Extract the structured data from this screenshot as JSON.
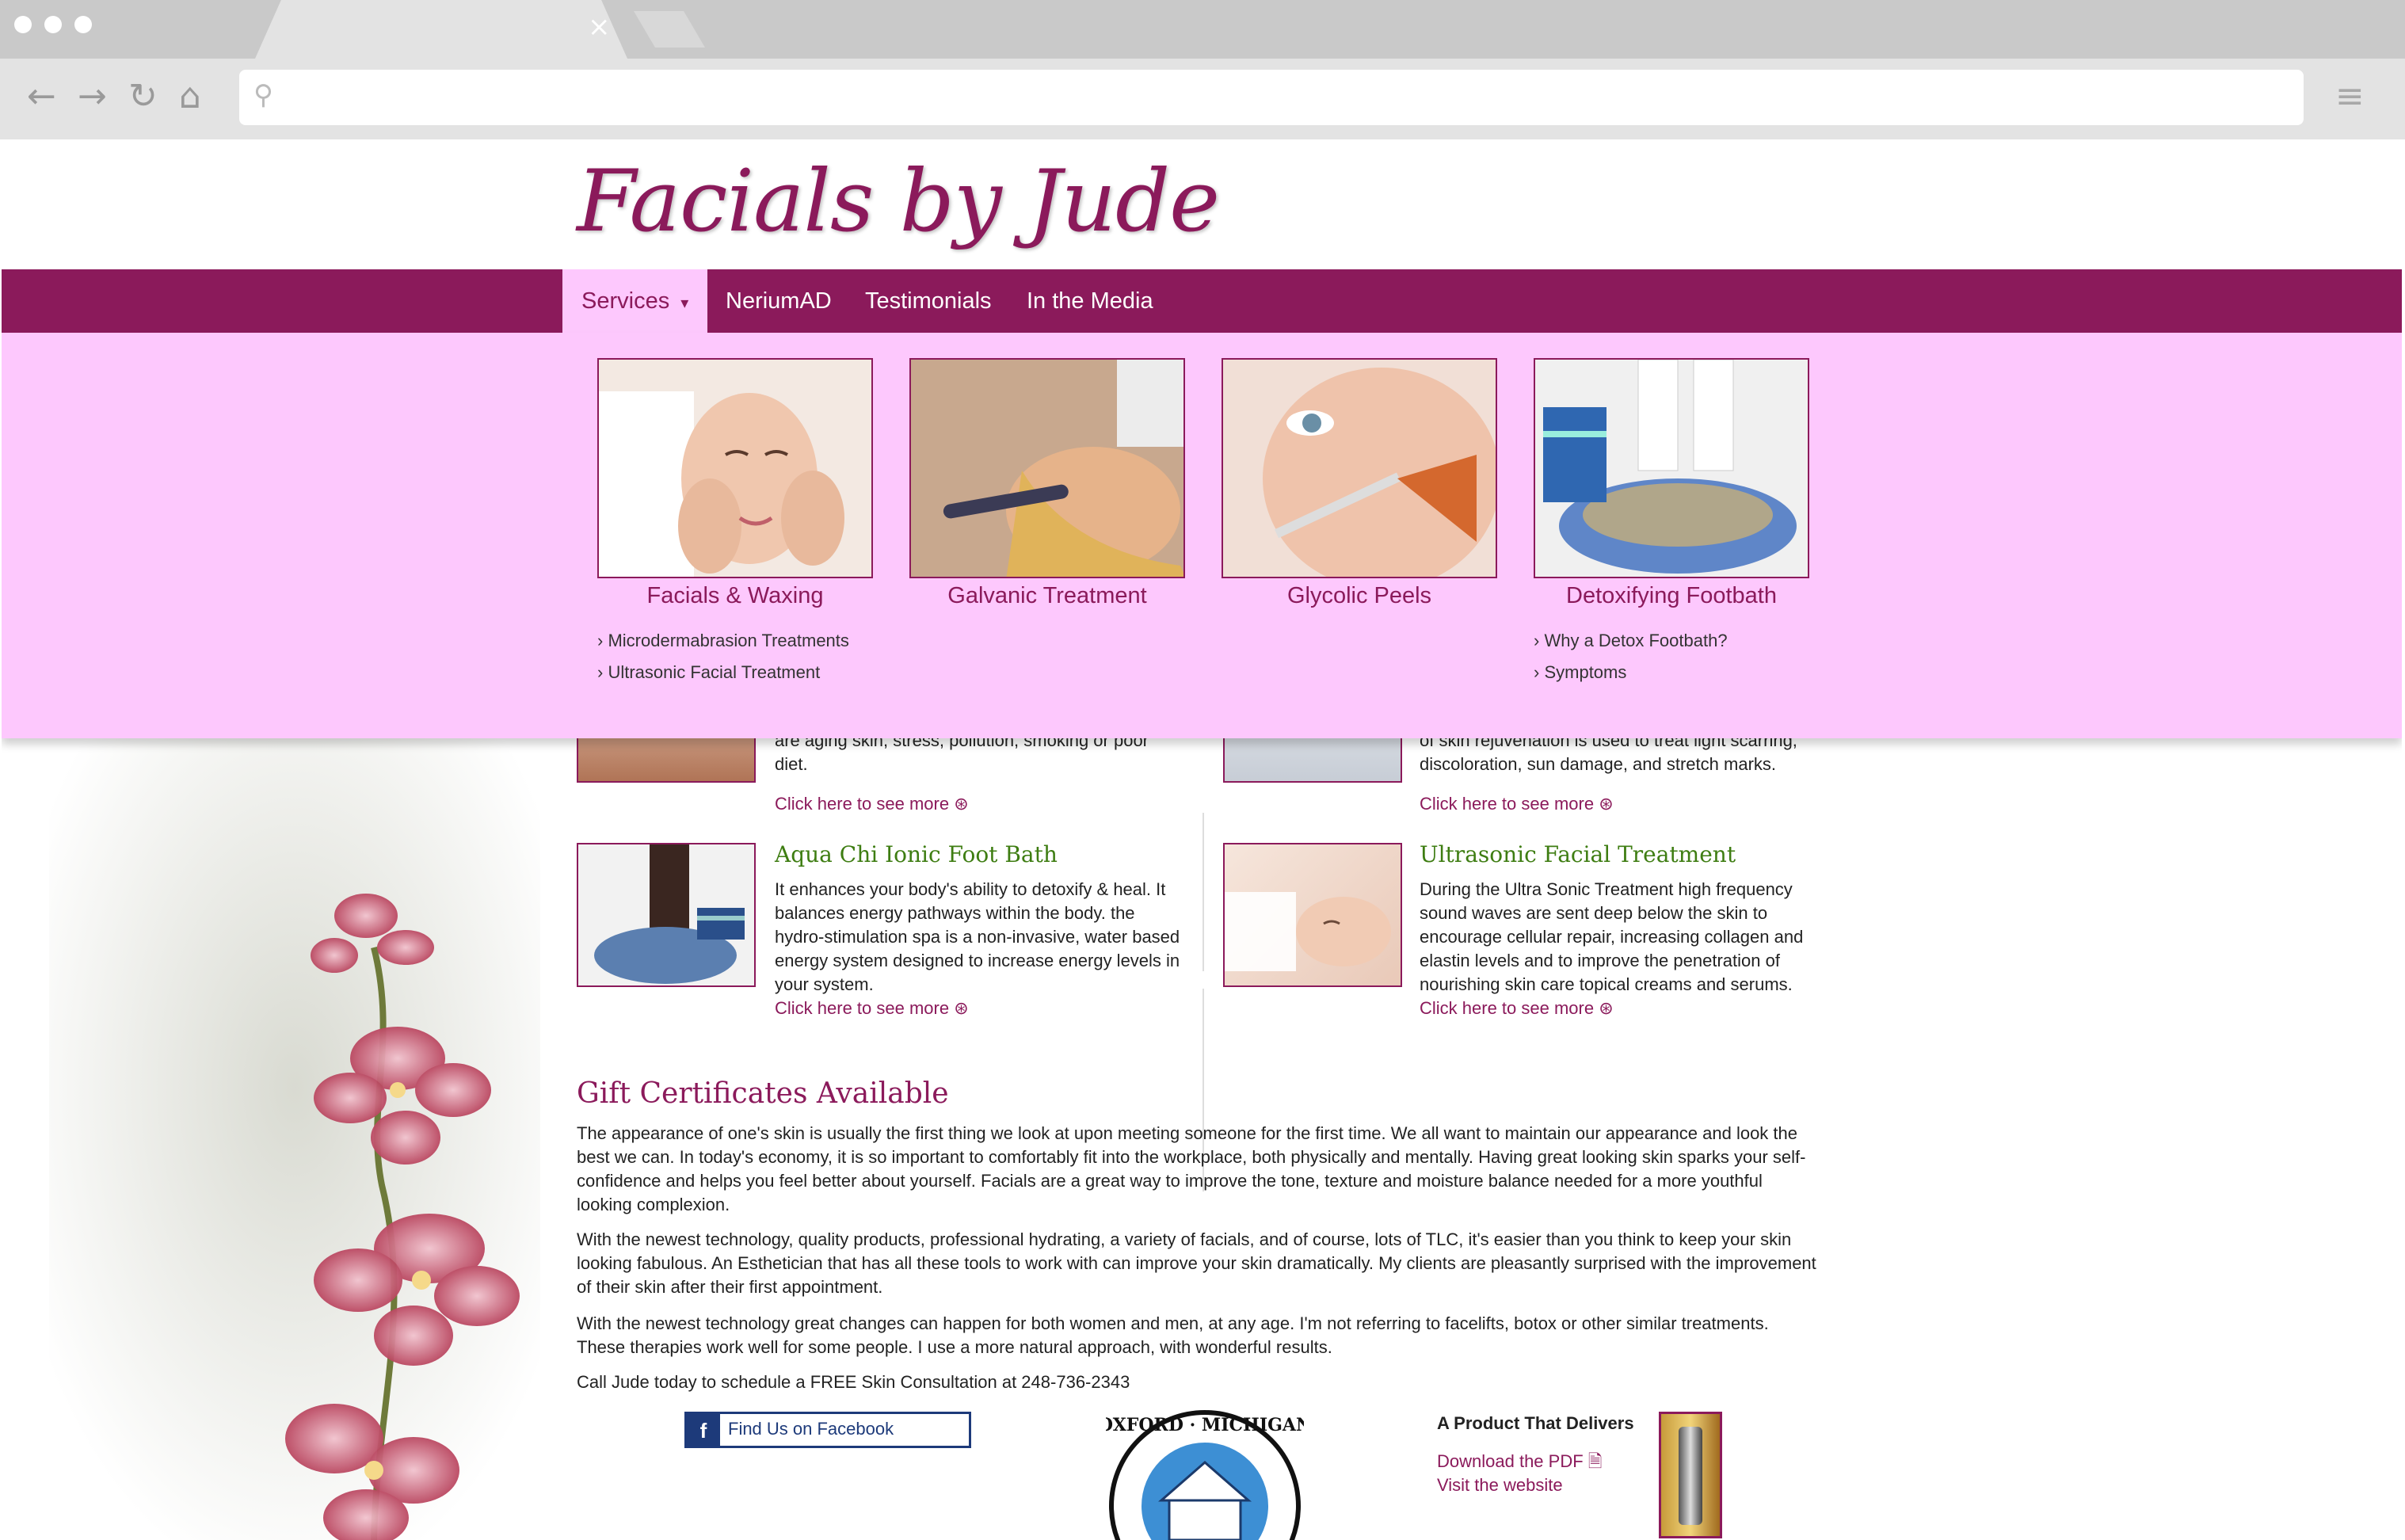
{
  "browser": {
    "tab_close": "×",
    "address_value": "",
    "icons": [
      "back-arrow-icon",
      "forward-arrow-icon",
      "reload-icon",
      "home-icon",
      "search-icon",
      "menu-icon"
    ]
  },
  "header": {
    "logo": "Facials by Jude"
  },
  "nav": {
    "items": [
      {
        "label": "Services",
        "caret": "▾",
        "active": true
      },
      {
        "label": "NeriumAD"
      },
      {
        "label": "Testimonials"
      },
      {
        "label": "In the Media"
      }
    ]
  },
  "mega_menu": {
    "cards": [
      {
        "title": "Facials & Waxing",
        "sub": [
          "Microdermabrasion Treatments",
          "Ultrasonic Facial Treatment"
        ]
      },
      {
        "title": "Galvanic Treatment",
        "sub": []
      },
      {
        "title": "Glycolic Peels",
        "sub": []
      },
      {
        "title": "Detoxifying Footbath",
        "sub": [
          "Why a Detox Footbath?",
          "Symptoms"
        ]
      }
    ]
  },
  "services": {
    "partial_left": [
      "are aging skin, stress, pollution, smoking or poor",
      "diet."
    ],
    "partial_right": [
      "of skin rejuvenation is used to treat light scarring,",
      "discoloration, sun damage, and stretch marks."
    ],
    "items": [
      {
        "title": "Aqua Chi Ionic Foot Bath",
        "lines": [
          "It enhances your body's ability to detoxify & heal. It",
          "balances energy pathways within the body. the",
          "hydro-stimulation spa is a non-invasive, water based",
          "energy system designed to increase energy levels in",
          "your system."
        ]
      },
      {
        "title": "Ultrasonic Facial Treatment",
        "lines": [
          "During the Ultra Sonic Treatment high frequency",
          "sound waves are sent deep below the skin to",
          "encourage cellular repair, increasing collagen and",
          "elastin levels and to improve the penetration of",
          "nourishing skin care topical creams and serums."
        ]
      }
    ],
    "more_label": "Click here to see more"
  },
  "gift": {
    "heading": "Gift Certificates Available",
    "paragraphs": [
      [
        "The appearance of one's skin is usually the first thing we look at upon meeting someone for the first time. We all want to maintain our appearance and look the",
        "best we can. In today's economy, it is so important to comfortably fit into the workplace, both physically and mentally. Having great looking skin sparks your self-",
        "confidence and helps you feel better about yourself. Facials are a great way to improve the tone, texture and moisture balance needed for a more youthful",
        "looking complexion."
      ],
      [
        "With the newest technology, quality products, professional hydrating, a variety of facials, and of course, lots of TLC, it's easier than you think to keep your skin",
        "looking fabulous. An Esthetician that has all these tools to work with can improve your skin dramatically. My clients are pleasantly surprised with the improvement",
        "of their skin after their first appointment."
      ],
      [
        "With the newest technology great changes can happen for both women and men, at any age. I'm not referring to facelifts, botox or other similar treatments.",
        "These therapies work well for some people. I use a more natural approach, with wonderful results."
      ],
      [
        "Call Jude today to schedule a FREE Skin Consultation at 248-736-2343"
      ]
    ]
  },
  "footer": {
    "facebook_icon": "f",
    "facebook_label": "Find Us on Facebook",
    "badge_text": "OXFORD · MICHIGAN",
    "product_heading": "A Product That Delivers",
    "download_label": "Download the PDF",
    "visit_label": "Visit the website"
  },
  "colors": {
    "brand": "#8b1a5b",
    "menu_bg": "#fdc8fd",
    "green_heading": "#3e7d12"
  }
}
